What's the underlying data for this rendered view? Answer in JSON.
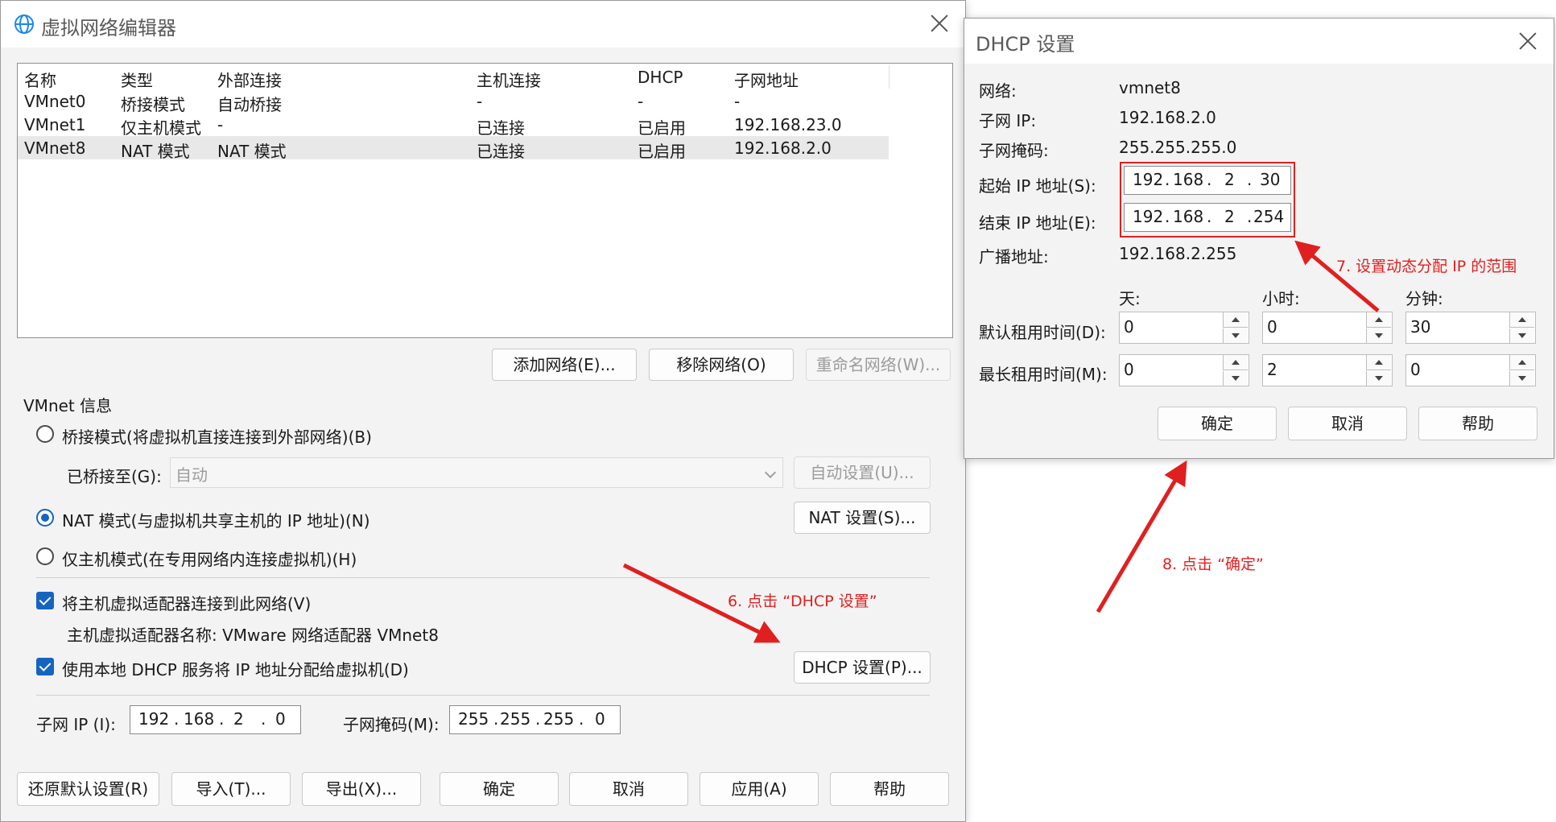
{
  "editor": {
    "title": "虚拟网络编辑器",
    "columns": [
      "名称",
      "类型",
      "外部连接",
      "主机连接",
      "DHCP",
      "子网地址"
    ],
    "rows": [
      [
        "VMnet0",
        "桥接模式",
        "自动桥接",
        "-",
        "-",
        "-"
      ],
      [
        "VMnet1",
        "仅主机模式",
        "-",
        "已连接",
        "已启用",
        "192.168.23.0"
      ],
      [
        "VMnet8",
        "NAT 模式",
        "NAT 模式",
        "已连接",
        "已启用",
        "192.168.2.0"
      ]
    ],
    "add_network": "添加网络(E)...",
    "remove_network": "移除网络(O)",
    "rename_network": "重命名网络(W)...",
    "vmnet_info": "VMnet 信息",
    "bridged_mode": "桥接模式(将虚拟机直接连接到外部网络)(B)",
    "bridged_to_label": "已桥接至(G):",
    "bridged_to_value": "自动",
    "auto_settings": "自动设置(U)...",
    "nat_mode": "NAT 模式(与虚拟机共享主机的 IP 地址)(N)",
    "nat_settings": "NAT 设置(S)...",
    "host_only_mode": "仅主机模式(在专用网络内连接虚拟机)(H)",
    "connect_adapter": "将主机虚拟适配器连接到此网络(V)",
    "adapter_name": "主机虚拟适配器名称: VMware 网络适配器 VMnet8",
    "use_dhcp": "使用本地 DHCP 服务将 IP 地址分配给虚拟机(D)",
    "dhcp_settings": "DHCP 设置(P)...",
    "subnet_ip_label": "子网 IP (I):",
    "subnet_ip": [
      "192",
      "168",
      "2",
      "0"
    ],
    "subnet_mask_label": "子网掩码(M):",
    "subnet_mask": [
      "255",
      "255",
      "255",
      "0"
    ],
    "restore_defaults": "还原默认设置(R)",
    "import": "导入(T)...",
    "export": "导出(X)...",
    "ok": "确定",
    "cancel": "取消",
    "apply": "应用(A)",
    "help": "帮助"
  },
  "dhcp": {
    "title": "DHCP 设置",
    "network_label": "网络:",
    "network_value": "vmnet8",
    "subnet_ip_label": "子网 IP:",
    "subnet_ip_value": "192.168.2.0",
    "subnet_mask_label": "子网掩码:",
    "subnet_mask_value": "255.255.255.0",
    "start_ip_label": "起始 IP 地址(S):",
    "start_ip": [
      "192",
      "168",
      "2",
      "30"
    ],
    "end_ip_label": "结束 IP 地址(E):",
    "end_ip": [
      "192",
      "168",
      "2",
      "254"
    ],
    "broadcast_label": "广播地址:",
    "broadcast_value": "192.168.2.255",
    "days_label": "天:",
    "hours_label": "小时:",
    "minutes_label": "分钟:",
    "default_lease_label": "默认租用时间(D):",
    "default_lease": [
      "0",
      "0",
      "30"
    ],
    "max_lease_label": "最长租用时间(M):",
    "max_lease": [
      "0",
      "2",
      "0"
    ],
    "ok": "确定",
    "cancel": "取消",
    "help": "帮助"
  },
  "annotations": {
    "step6": "6. 点击 “DHCP 设置”",
    "step7": "7. 设置动态分配 IP 的范围",
    "step8": "8. 点击 “确定”",
    "color": "#e02020"
  },
  "colors": {
    "accent": "#1565c0",
    "window_bg": "#f3f3f3",
    "selected_row": "#e8e8e8"
  }
}
